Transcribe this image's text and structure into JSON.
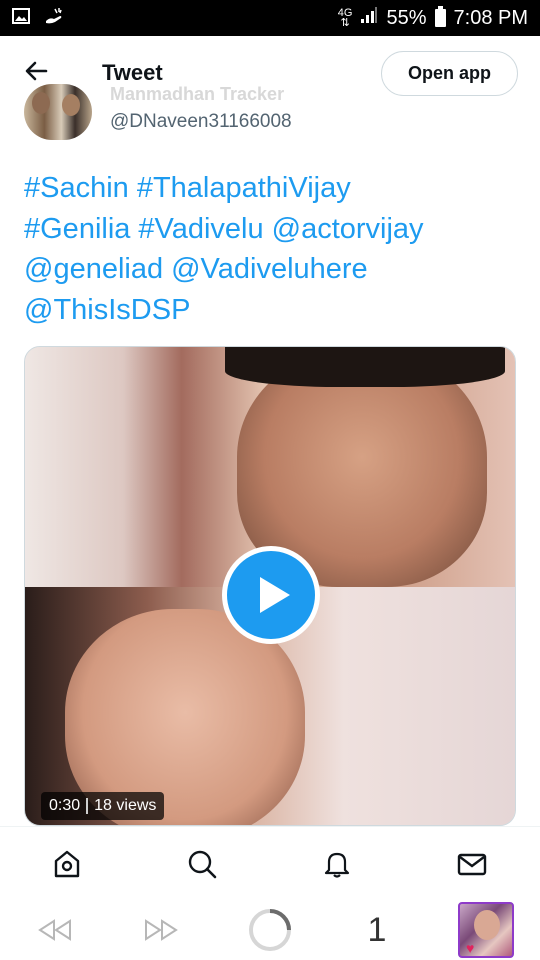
{
  "status_bar": {
    "network_top": "4G",
    "battery": "55%",
    "time": "7:08 PM",
    "icons": [
      "image-icon",
      "hand-wave-icon",
      "data-arrows-icon",
      "signal-icon",
      "battery-icon"
    ]
  },
  "header": {
    "title": "Tweet",
    "open_app_label": "Open app",
    "back_icon": "arrow-left-icon"
  },
  "author": {
    "name": "Manmadhan Tracker",
    "handle": "@DNaveen31166008"
  },
  "tweet": {
    "tokens": [
      "#Sachin",
      "#ThalapathiVijay",
      "#Genilia",
      "#Vadivelu",
      "@actorvijay",
      "@geneliad",
      "@Vadiveluhere",
      "@ThisIsDSP"
    ]
  },
  "video": {
    "duration": "0:30",
    "views": "18 views",
    "play_icon": "play-icon"
  },
  "bottom_nav": {
    "items": [
      "home-icon",
      "search-icon",
      "notifications-icon",
      "messages-icon"
    ]
  },
  "browser_bar": {
    "tab_count": "1",
    "items": [
      "rewind-icon",
      "fast-forward-icon",
      "loading-icon",
      "tab-count",
      "tab-thumbnail"
    ]
  },
  "colors": {
    "accent": "#1d9bf0",
    "text_primary": "#0f1419",
    "text_secondary": "#536471",
    "status_bar_bg": "#000000"
  }
}
